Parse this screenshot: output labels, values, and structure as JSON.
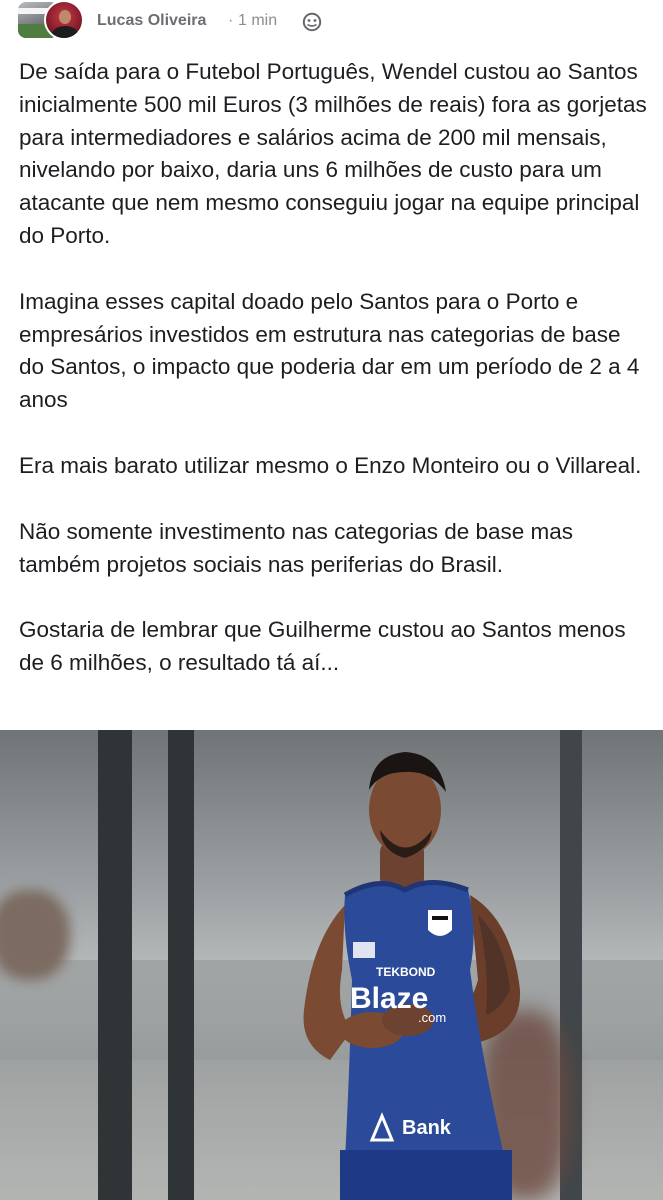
{
  "post": {
    "author": "Lucas Oliveira",
    "separator": "·",
    "time": "1 min",
    "privacy_icon": "globe-icon",
    "paragraphs": [
      "De saída para o Futebol Português, Wendel custou ao Santos inicialmente 500 mil Euros (3 milhões de reais) fora as gorjetas para intermediadores e salários acima de 200 mil mensais, nivelando por baixo, daria uns 6 milhões de custo para um atacante que nem mesmo conseguiu jogar na equipe principal do Porto.",
      "Imagina esses capital doado pelo Santos para o Porto e empresários investidos em estrutura nas categorias de base do Santos, o impacto que poderia dar em um período de 2 a 4 anos",
      "Era mais barato utilizar mesmo o Enzo Monteiro ou o Villareal.",
      "Não somente investimento nas categorias de base mas também projetos sociais nas periferias do Brasil.",
      "Gostaria de lembrar que Guilherme custou ao Santos menos de 6 milhões, o resultado tá aí..."
    ]
  },
  "photo": {
    "shirt_sponsor": "Blaze",
    "shirt_sponsor_sub": ".com",
    "shirt_lower_sponsor": "Bank",
    "shirt_chest_sponsor": "TEKBOND",
    "colors": {
      "jersey": "#2c4a9a",
      "skin": "#7a4a33"
    }
  }
}
